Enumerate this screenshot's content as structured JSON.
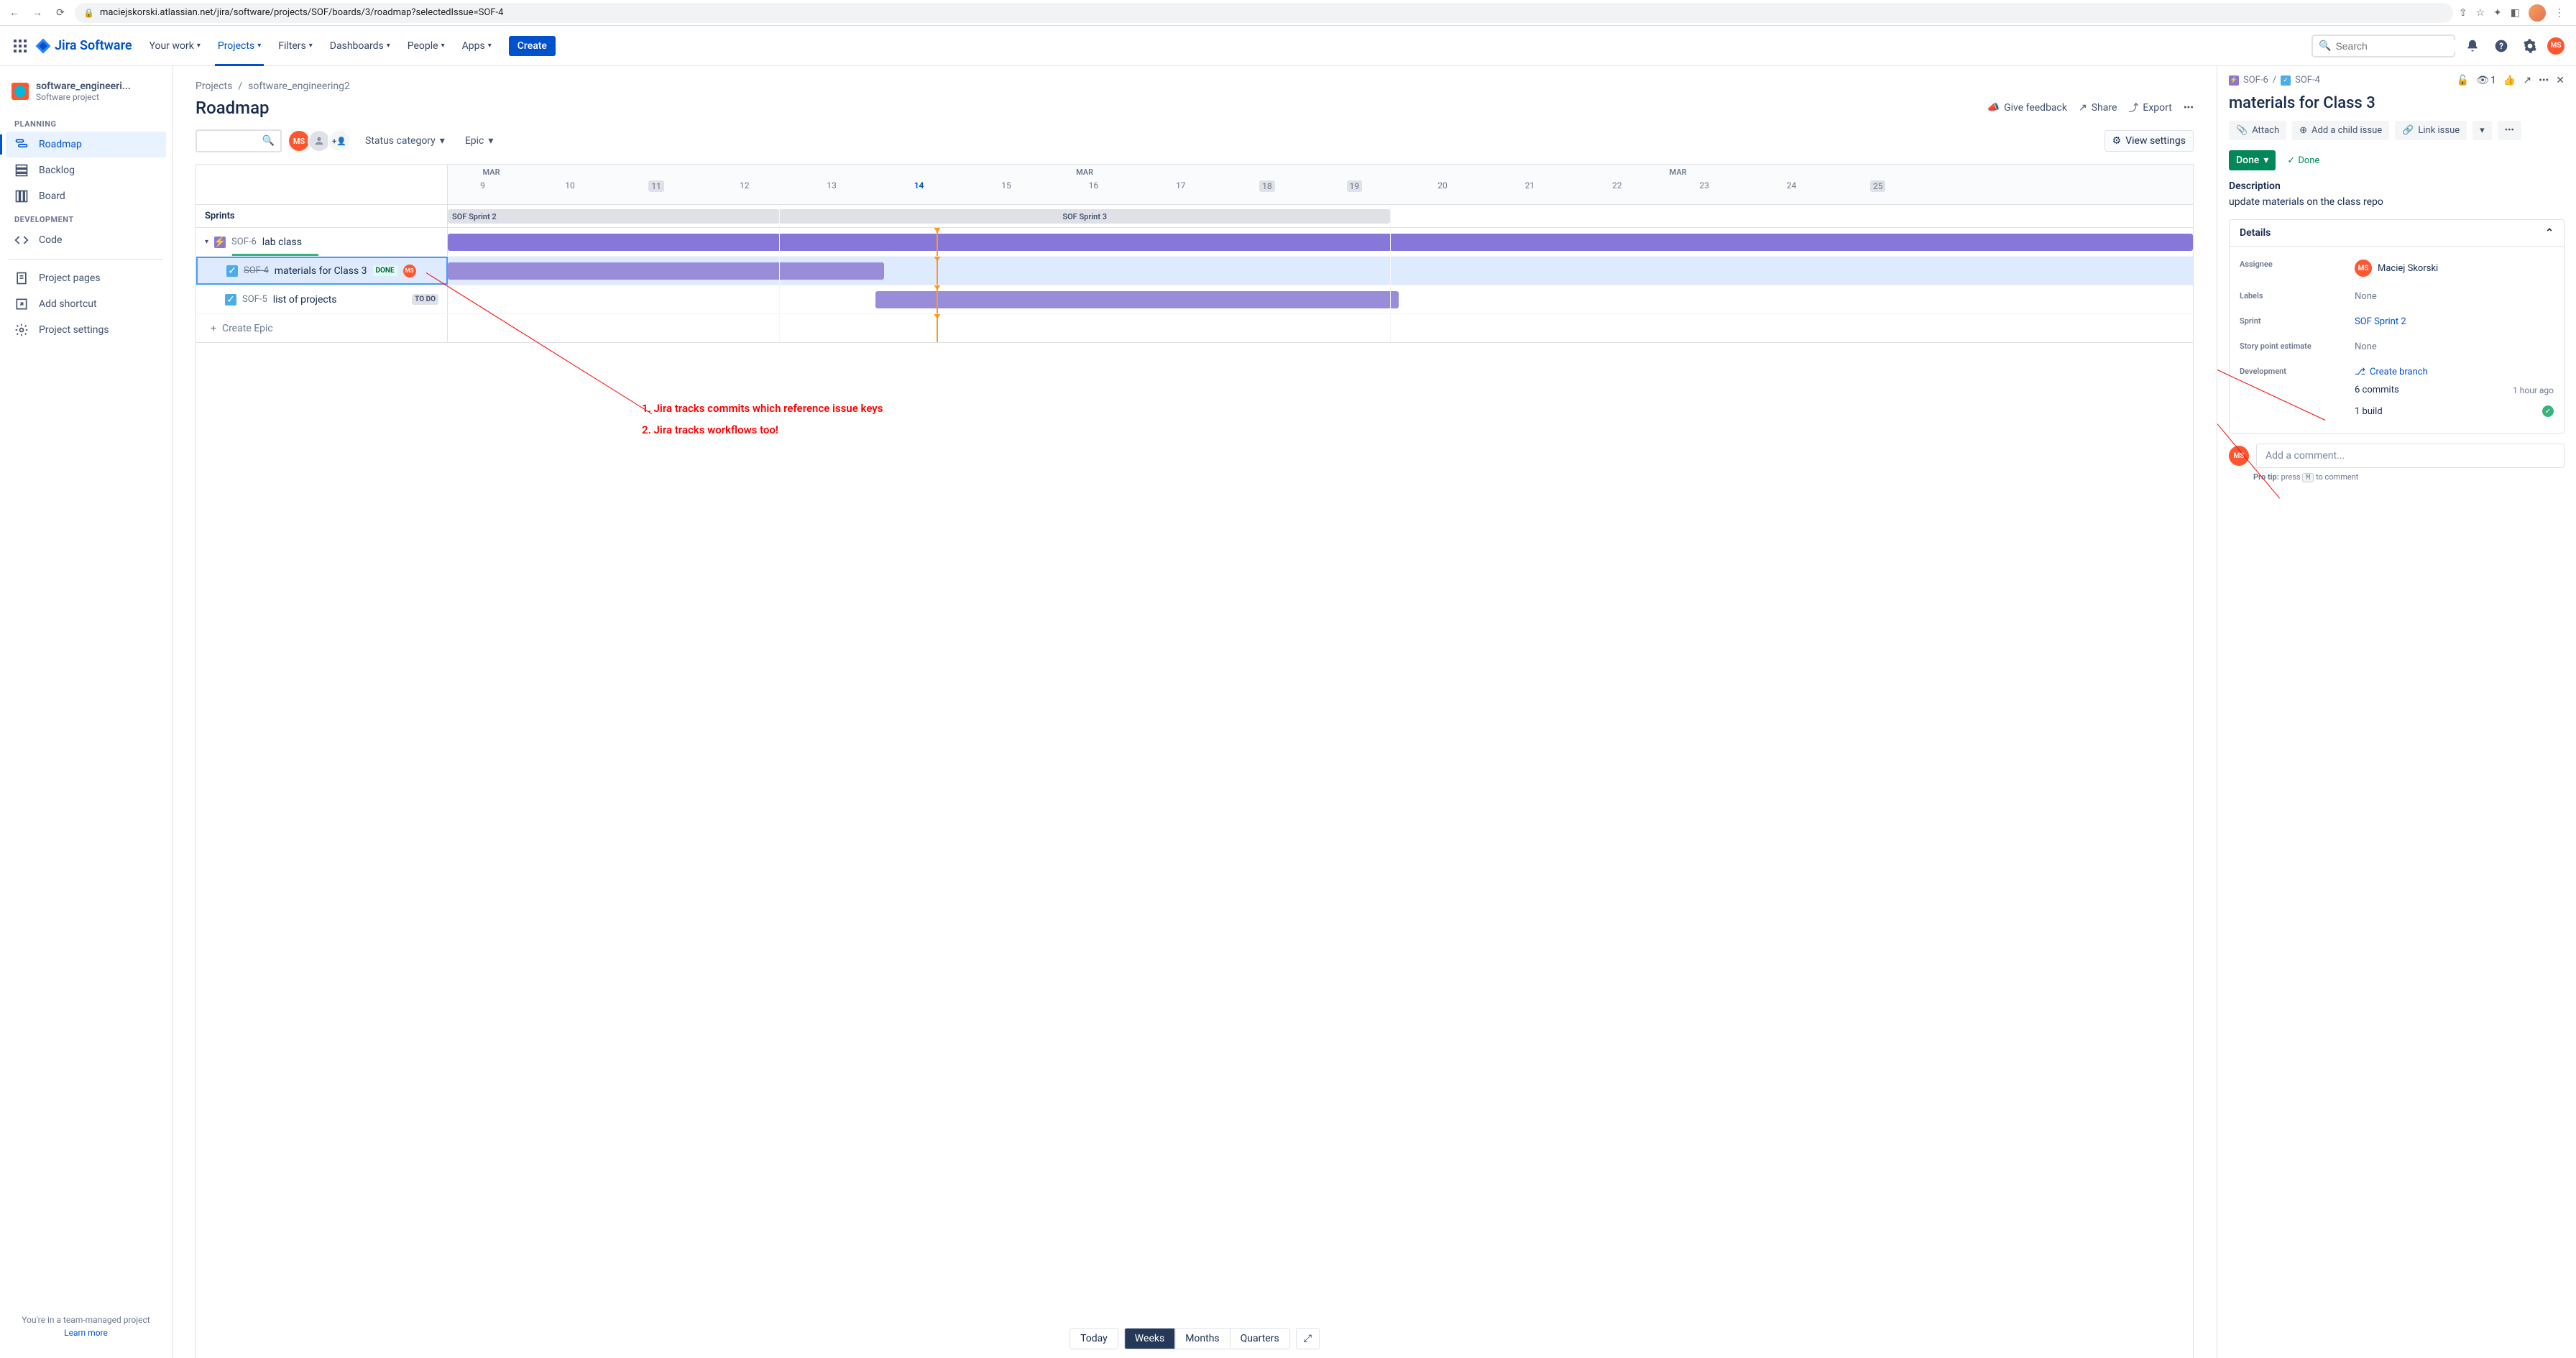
{
  "browser": {
    "url": "maciejskorski.atlassian.net/jira/software/projects/SOF/boards/3/roadmap?selectedIssue=SOF-4"
  },
  "nav": {
    "product": "Jira Software",
    "items": [
      "Your work",
      "Projects",
      "Filters",
      "Dashboards",
      "People",
      "Apps"
    ],
    "create": "Create",
    "search_placeholder": "Search",
    "avatar_initials": "MS"
  },
  "sidebar": {
    "project_name": "software_engineeri...",
    "project_type": "Software project",
    "sections": {
      "planning": "PLANNING",
      "development": "DEVELOPMENT"
    },
    "items": {
      "roadmap": "Roadmap",
      "backlog": "Backlog",
      "board": "Board",
      "code": "Code",
      "project_pages": "Project pages",
      "add_shortcut": "Add shortcut",
      "project_settings": "Project settings"
    },
    "footer": "You're in a team-managed project",
    "footer_link": "Learn more"
  },
  "breadcrumb": {
    "projects": "Projects",
    "project": "software_engineering2"
  },
  "page": {
    "title": "Roadmap",
    "feedback": "Give feedback",
    "share": "Share",
    "export": "Export",
    "view_settings": "View settings"
  },
  "filters": {
    "status": "Status category",
    "epic": "Epic"
  },
  "timeline": {
    "month": "MAR",
    "days": [
      "9",
      "10",
      "11",
      "12",
      "13",
      "14",
      "15",
      "16",
      "17",
      "18",
      "19",
      "20",
      "21",
      "22",
      "23",
      "24",
      "25"
    ],
    "sprints_label": "Sprints",
    "sprint1": "SOF Sprint 2",
    "sprint2": "SOF Sprint 3",
    "epic": {
      "key": "SOF-6",
      "summary": "lab class"
    },
    "task1": {
      "key": "SOF-4",
      "summary": "materials for Class 3",
      "status": "DONE"
    },
    "task2": {
      "key": "SOF-5",
      "summary": "list of projects",
      "status": "TO DO"
    },
    "create_epic": "Create Epic",
    "today": "Today",
    "weeks": "Weeks",
    "months": "Months",
    "quarters": "Quarters"
  },
  "annotations": {
    "line1": "1. Jira tracks commits which reference issue keys",
    "line2": "2. Jira tracks workflows too!"
  },
  "detail": {
    "parent_key": "SOF-6",
    "key": "SOF-4",
    "watch_count": "1",
    "title": "materials for Class 3",
    "attach": "Attach",
    "add_child": "Add a child issue",
    "link_issue": "Link issue",
    "status": "Done",
    "status_check": "Done",
    "desc_label": "Description",
    "desc_text": "update materials on the class repo",
    "details_label": "Details",
    "fields": {
      "assignee_label": "Assignee",
      "assignee_value": "Maciej Skorski",
      "labels_label": "Labels",
      "labels_value": "None",
      "sprint_label": "Sprint",
      "sprint_value": "SOF Sprint 2",
      "story_label": "Story point estimate",
      "story_value": "None",
      "dev_label": "Development",
      "create_branch": "Create branch",
      "commits": "6 commits",
      "commits_time": "1 hour ago",
      "build": "1 build"
    },
    "comment_placeholder": "Add a comment...",
    "pro_tip_prefix": "Pro tip:",
    "pro_tip_text": "press",
    "pro_tip_key": "M",
    "pro_tip_suffix": "to comment"
  }
}
